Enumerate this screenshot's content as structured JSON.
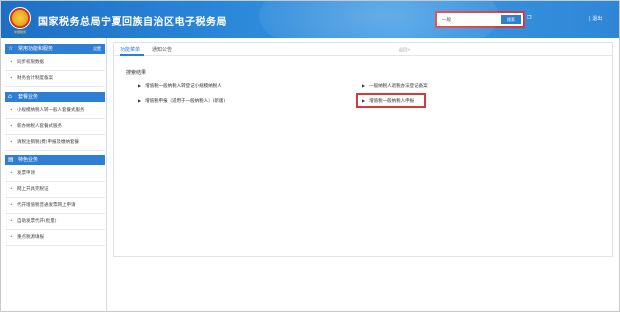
{
  "header": {
    "title": "国家税务总局宁夏回族自治区电子税务局",
    "emblem_text": "中国税务",
    "search": {
      "value": "一般",
      "button_label": "搜索"
    },
    "icons_text": "❐",
    "right_link": "| 退出"
  },
  "sidebar": {
    "sections": [
      {
        "icon": "star-icon",
        "label": "常用功能和服务",
        "more": "设置",
        "items": [
          {
            "label": "同步权限数据"
          },
          {
            "label": "财务会计制度备案"
          }
        ]
      },
      {
        "icon": "home-icon",
        "label": "套餐业务",
        "items": [
          {
            "label": "小规模纳税人转一般人套餐式服务"
          },
          {
            "label": "新办纳税人套餐式服务"
          },
          {
            "label": "清税注销税(费)申报及缴纳套餐"
          }
        ]
      },
      {
        "icon": "doc-icon",
        "label": "特色业务",
        "items": [
          {
            "label": "发票申领"
          },
          {
            "label": "网上开具完税证"
          },
          {
            "label": "代开增值税普通发票网上申请"
          },
          {
            "label": "自助发票代开(批量)"
          },
          {
            "label": "重点税源填报"
          }
        ]
      }
    ]
  },
  "main": {
    "tabs": [
      {
        "label": "功能菜单"
      },
      {
        "label": "通知公告"
      }
    ],
    "tab_more": "返回>",
    "result_title": "搜索结果",
    "results": [
      {
        "label": "增值税一般纳税人转登记小规模纳税人"
      },
      {
        "label": "一般纳税人退税办法登记备案"
      },
      {
        "label": "增值税申报（适用于一般纳税人）(新版)"
      },
      {
        "label": "增值税一般纳税人申报"
      }
    ]
  },
  "colors": {
    "accent": "#2f7ed6",
    "highlight": "#d63a3a"
  }
}
